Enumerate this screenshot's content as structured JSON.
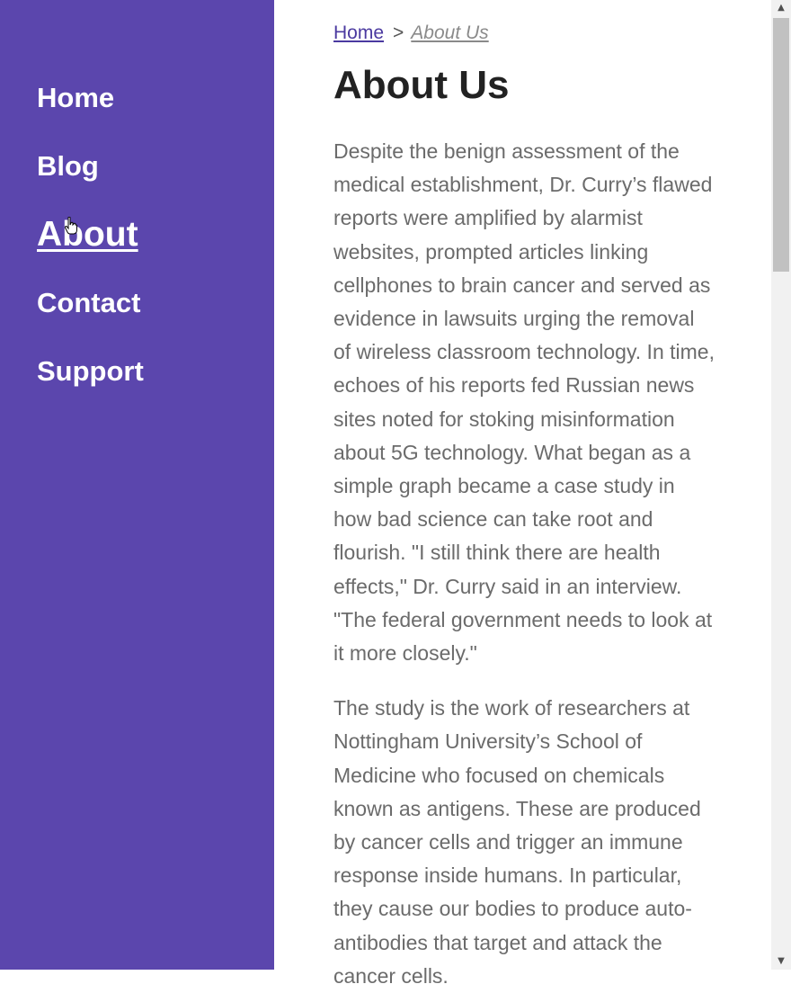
{
  "sidebar": {
    "nav": [
      {
        "label": "Home"
      },
      {
        "label": "Blog"
      },
      {
        "label": "About"
      },
      {
        "label": "Contact"
      },
      {
        "label": "Support"
      }
    ],
    "active": "About"
  },
  "breadcrumb": {
    "home": "Home",
    "separator": ">",
    "current": "About Us"
  },
  "main": {
    "title": "About Us",
    "paragraphs": [
      "Despite the benign assessment of the medical establishment, Dr. Curry’s flawed reports were amplified by alarmist websites, prompted articles linking cellphones to brain cancer and served as evidence in lawsuits urging the removal of wireless classroom technology. In time, echoes of his reports fed Russian news sites noted for stoking misinformation about 5G technology. What began as a simple graph became a case study in how bad science can take root and flourish. \"I still think there are health effects,\" Dr. Curry said in an interview. \"The federal government needs to look at it more closely.\"",
      "The study is the work of researchers at Nottingham University’s School of Medicine who focused on chemicals known as antigens. These are produced by cancer cells and trigger an immune response inside humans. In particular, they cause our bodies to produce auto-antibodies that target and attack the cancer cells."
    ]
  },
  "colors": {
    "sidebar_bg": "#5b46ad",
    "nav_text": "#ffffff",
    "link": "#4b3aa0",
    "body_text": "#6b6b6b",
    "title_text": "#222222"
  },
  "icons": {
    "cursor": "hand-pointer-icon",
    "scroll_up": "scroll-up-arrow-icon",
    "scroll_down": "scroll-down-arrow-icon"
  }
}
